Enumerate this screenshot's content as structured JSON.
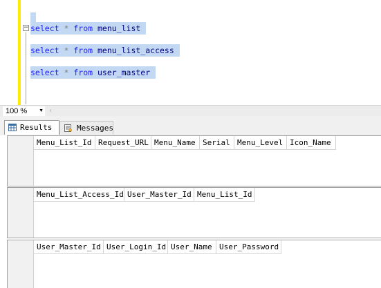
{
  "editor": {
    "lines": [
      {
        "kw1": "select",
        "op": "*",
        "kw2": "from",
        "table": "menu_list"
      },
      {
        "kw1": "select",
        "op": "*",
        "kw2": "from",
        "table": "menu_list_access"
      },
      {
        "kw1": "select",
        "op": "*",
        "kw2": "from",
        "table": "user_master"
      }
    ],
    "collapse_glyph": "−"
  },
  "zoom": {
    "value": "100 %",
    "dropdown_glyph": "▼",
    "scroll_left_glyph": "‹"
  },
  "tabs": [
    {
      "label": "Results",
      "icon": "grid-icon",
      "active": true
    },
    {
      "label": "Messages",
      "icon": "messages-icon",
      "active": false
    }
  ],
  "result_grids": [
    {
      "columns": [
        "Menu_List_Id",
        "Request_URL",
        "Menu_Name",
        "Serial",
        "Menu_Level",
        "Icon_Name"
      ],
      "rows": []
    },
    {
      "columns": [
        "Menu_List_Access_Id",
        "User_Master_Id",
        "Menu_List_Id"
      ],
      "rows": []
    },
    {
      "columns": [
        "User_Master_Id",
        "User_Login_Id",
        "User_Name",
        "User_Password"
      ],
      "rows": []
    }
  ],
  "colors": {
    "selection": "#c3d9f3",
    "keyword": "#1e1eff",
    "identifier": "#000080",
    "change_bar": "#ffec00"
  }
}
